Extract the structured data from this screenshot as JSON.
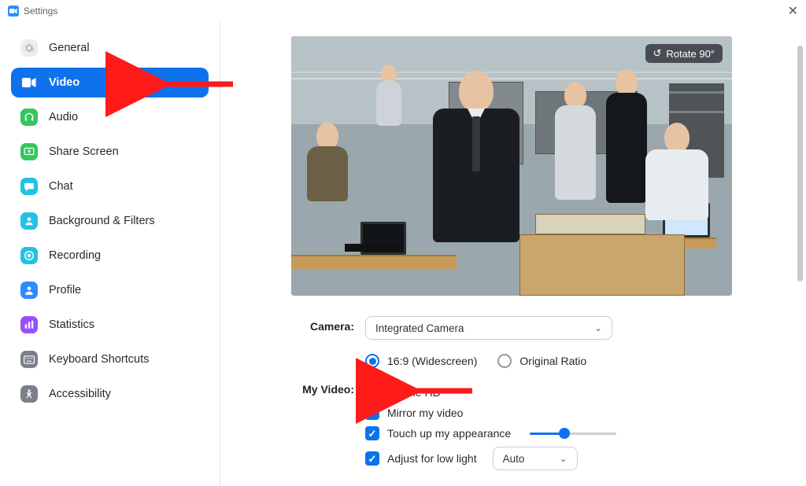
{
  "window": {
    "title": "Settings"
  },
  "sidebar": {
    "items": [
      {
        "label": "General"
      },
      {
        "label": "Video"
      },
      {
        "label": "Audio"
      },
      {
        "label": "Share Screen"
      },
      {
        "label": "Chat"
      },
      {
        "label": "Background & Filters"
      },
      {
        "label": "Recording"
      },
      {
        "label": "Profile"
      },
      {
        "label": "Statistics"
      },
      {
        "label": "Keyboard Shortcuts"
      },
      {
        "label": "Accessibility"
      }
    ],
    "active_index": 1
  },
  "preview": {
    "rotate_label": "Rotate 90°"
  },
  "form": {
    "camera_label": "Camera:",
    "camera_selected": "Integrated Camera",
    "aspect": {
      "widescreen": "16:9 (Widescreen)",
      "original": "Original Ratio",
      "selected": "widescreen"
    },
    "myvideo_label": "My Video:",
    "enable_hd": {
      "label": "Enable HD",
      "checked": false
    },
    "mirror": {
      "label": "Mirror my video",
      "checked": true
    },
    "touchup": {
      "label": "Touch up my appearance",
      "checked": true,
      "slider_pct": 40
    },
    "lowlight": {
      "label": "Adjust for low light",
      "checked": true,
      "mode": "Auto"
    }
  },
  "colors": {
    "primary": "#0e72ed"
  }
}
